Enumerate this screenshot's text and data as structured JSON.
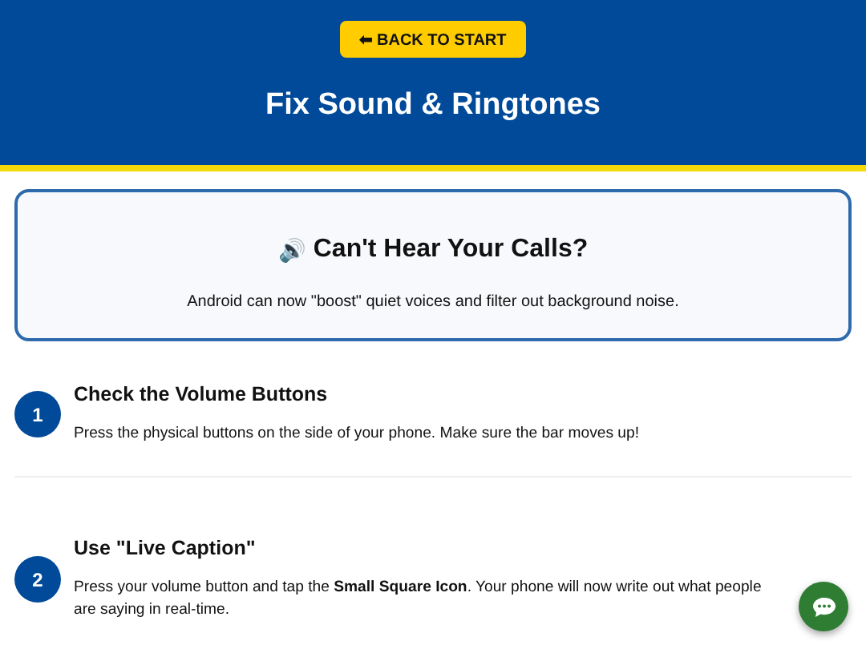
{
  "header": {
    "back_button": "⬅ BACK TO START",
    "title": "Fix Sound & Ringtones"
  },
  "intro": {
    "icon": "🔊",
    "title": "Can't Hear Your Calls?",
    "text": "Android can now \"boost\" quiet voices and filter out background noise."
  },
  "steps": [
    {
      "number": "1",
      "title": "Check the Volume Buttons",
      "text": "Press the physical buttons on the side of your phone. Make sure the bar moves up!"
    },
    {
      "number": "2",
      "title": "Use \"Live Caption\"",
      "text": "Press your volume button and tap the **Small Square Icon**. Your phone will now write out what people are saying in real-time."
    }
  ]
}
